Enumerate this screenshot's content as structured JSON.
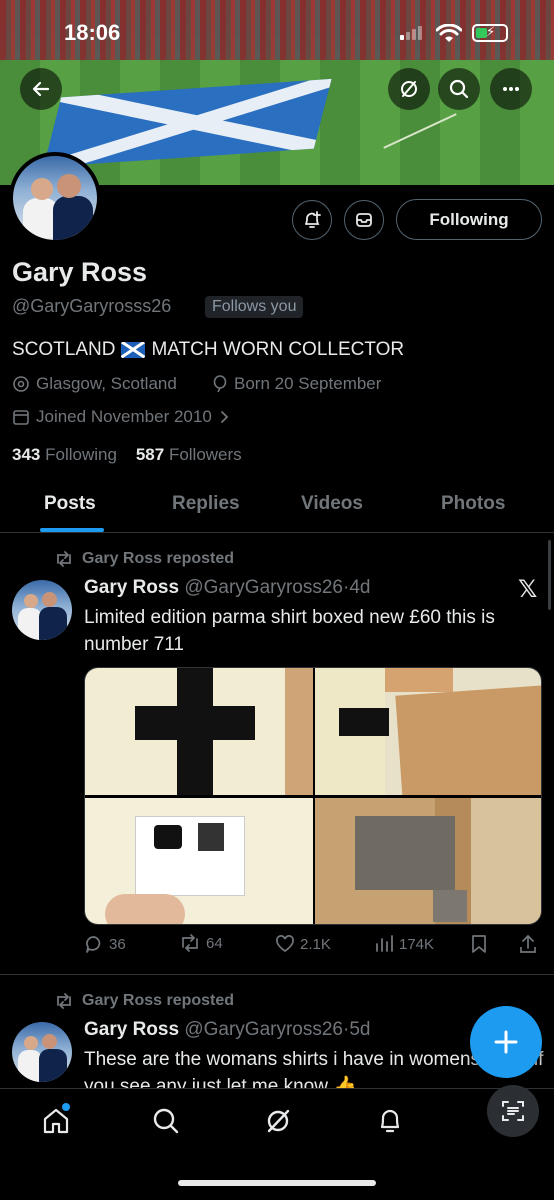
{
  "status_bar": {
    "time": "18:06"
  },
  "banner": {
    "description_icons": [
      "back-arrow-icon",
      "topics-icon",
      "search-icon",
      "more-icon"
    ]
  },
  "profile": {
    "name": "Gary Ross",
    "handle": "@GaryGaryrosss26",
    "follows_you": "Follows you",
    "bio_part1": "SCOTLAND",
    "bio_part2": "MATCH WORN COLLECTOR",
    "location": "Glasgow, Scotland",
    "born": "Born 20 September",
    "joined": "Joined November 2010",
    "following_count": "343",
    "following_label": "Following",
    "followers_count": "587",
    "followers_label": "Followers",
    "follow_button": "Following"
  },
  "tabs": [
    {
      "label": "Posts"
    },
    {
      "label": "Replies"
    },
    {
      "label": "Videos"
    },
    {
      "label": "Photos"
    }
  ],
  "posts": [
    {
      "repost_label": "Gary Ross reposted",
      "name": "Gary Ross",
      "handle": "@GaryGaryross26",
      "sep": "·",
      "time": "4d",
      "text": "Limited edition parma shirt boxed new £60 this is number 711",
      "replies": "36",
      "reposts": "64",
      "likes": "2.1K",
      "views": "174K"
    },
    {
      "repost_label": "Gary Ross reposted",
      "name": "Gary Ross",
      "handle": "@GaryGaryross26",
      "sep": "·",
      "time": "5d",
      "text": "These are the womans shirts i have in womens sizes if you see any just let me know 👍"
    }
  ],
  "colors": {
    "accent": "#1d9bf0",
    "background": "#000000",
    "text_primary": "#e7e9ea",
    "text_secondary": "#71767b",
    "border": "#2f3336"
  }
}
